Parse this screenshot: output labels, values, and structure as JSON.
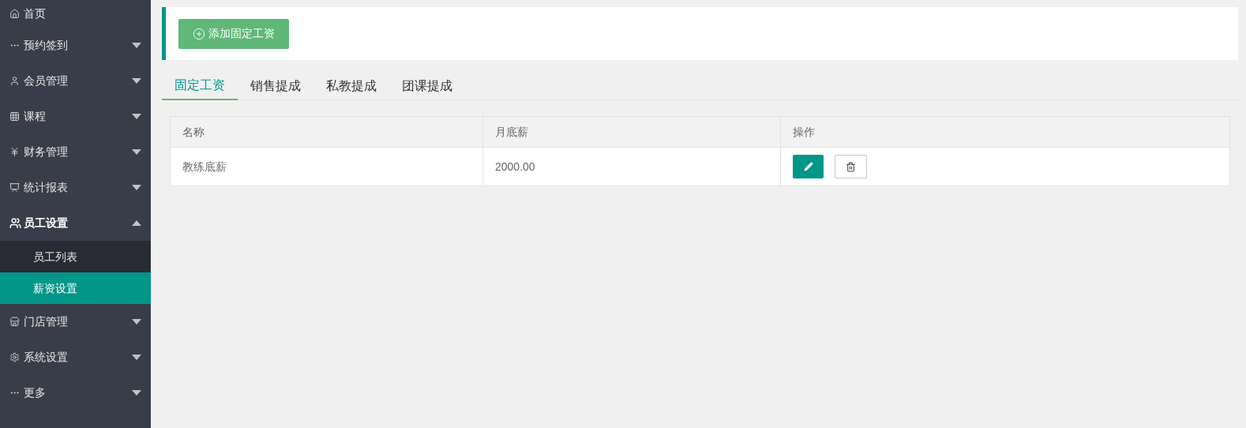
{
  "sidebar": {
    "items": [
      {
        "label": "首页",
        "kind": "home",
        "expandable": false,
        "expanded": false
      },
      {
        "label": "预约签到",
        "kind": "dots",
        "expandable": true,
        "expanded": false
      },
      {
        "label": "会员管理",
        "kind": "user",
        "expandable": true,
        "expanded": false
      },
      {
        "label": "课程",
        "kind": "grid",
        "expandable": true,
        "expanded": false
      },
      {
        "label": "财务管理",
        "kind": "yen",
        "expandable": true,
        "expanded": false
      },
      {
        "label": "统计报表",
        "kind": "monitor",
        "expandable": true,
        "expanded": false
      },
      {
        "label": "员工设置",
        "kind": "users",
        "expandable": true,
        "expanded": true,
        "children": [
          {
            "label": "员工列表",
            "selected": false
          },
          {
            "label": "薪资设置",
            "selected": true
          }
        ]
      },
      {
        "label": "门店管理",
        "kind": "store",
        "expandable": true,
        "expanded": false
      },
      {
        "label": "系统设置",
        "kind": "gear",
        "expandable": true,
        "expanded": false
      },
      {
        "label": "更多",
        "kind": "dots",
        "expandable": true,
        "expanded": false
      }
    ]
  },
  "add_button": {
    "label": "添加固定工资"
  },
  "tabs": [
    {
      "label": "固定工资",
      "selected": true
    },
    {
      "label": "销售提成",
      "selected": false
    },
    {
      "label": "私教提成",
      "selected": false
    },
    {
      "label": "团课提成",
      "selected": false
    }
  ],
  "table": {
    "columns": [
      "名称",
      "月底薪",
      "操作"
    ],
    "rows": [
      {
        "name": "教练底薪",
        "salary": "2000.00"
      }
    ]
  }
}
